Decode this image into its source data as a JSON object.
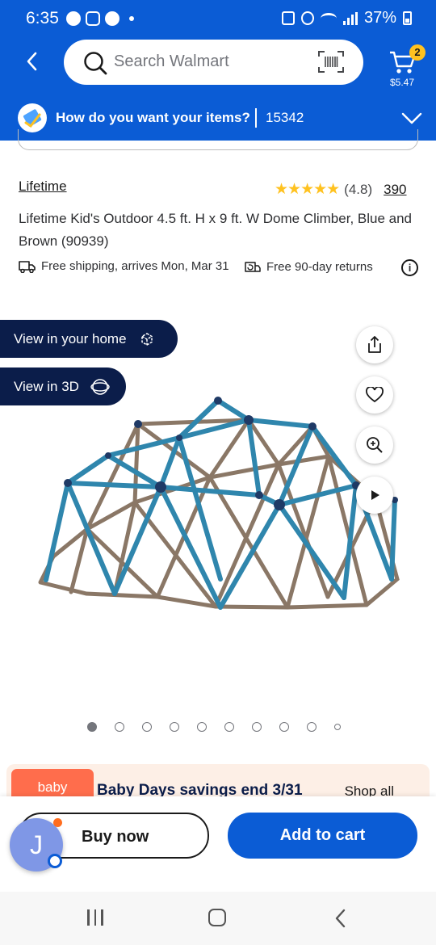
{
  "status_bar": {
    "time": "6:35",
    "battery": "37%"
  },
  "header": {
    "search_placeholder": "Search Walmart",
    "cart_count": "2",
    "cart_total": "$5.47"
  },
  "delivery": {
    "question": "How do you want your items?",
    "zip": "15342"
  },
  "product": {
    "brand": "Lifetime",
    "rating_value": 4.8,
    "rating_label": "(4.8)",
    "review_count": "390",
    "title": "Lifetime Kid's Outdoor 4.5 ft. H x 9 ft. W Dome Climber, Blue and Brown (90939)",
    "shipping": "Free shipping, arrives Mon, Mar 31",
    "returns": "Free 90-day returns"
  },
  "media": {
    "view_home": "View in your home",
    "view_3d": "View in 3D",
    "image_count": 10,
    "active_index": 0
  },
  "promo": {
    "logo": "baby",
    "text": "Baby Days savings end 3/31",
    "link": "Shop all"
  },
  "actions": {
    "buy_now": "Buy now",
    "add_to_cart": "Add to cart",
    "avatar_initial": "J"
  },
  "colors": {
    "brand_blue": "#0b5cd5",
    "navy": "#0b1d4a",
    "spark_yellow": "#ffc220",
    "dome_blue": "#2f86ad",
    "dome_brown": "#8a7766"
  }
}
